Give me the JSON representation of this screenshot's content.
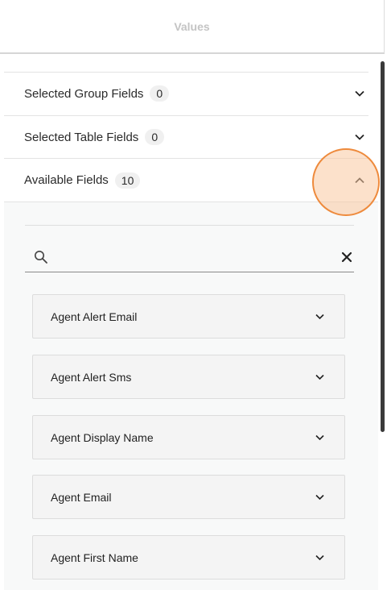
{
  "header": {
    "title": "Values"
  },
  "accordion": {
    "selected_group": {
      "label": "Selected Group Fields",
      "count": "0"
    },
    "selected_table": {
      "label": "Selected Table Fields",
      "count": "0"
    },
    "available": {
      "label": "Available Fields",
      "count": "10"
    }
  },
  "search": {
    "placeholder": "",
    "value": ""
  },
  "fields": [
    {
      "label": "Agent Alert Email"
    },
    {
      "label": "Agent Alert Sms"
    },
    {
      "label": "Agent Display Name"
    },
    {
      "label": "Agent Email"
    },
    {
      "label": "Agent First Name"
    }
  ],
  "icons": {
    "search": "search-icon",
    "clear": "close-icon",
    "expand": "chevron-down-icon",
    "collapse": "chevron-up-icon"
  },
  "colors": {
    "click_indicator": "#ee8a3c",
    "badge_bg": "#f0f0f0",
    "panel_bg": "#f8f9f9"
  }
}
